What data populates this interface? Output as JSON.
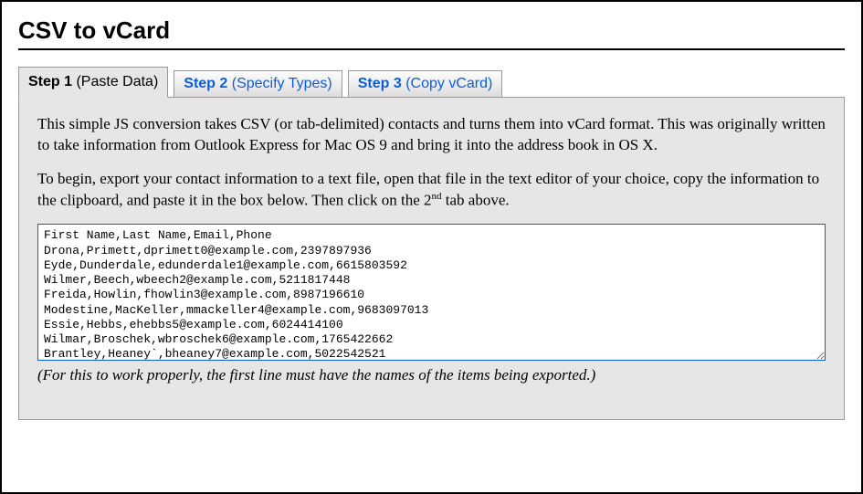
{
  "title": "CSV to vCard",
  "tabs": [
    {
      "label": "Step 1",
      "sub": "(Paste Data)",
      "active": true
    },
    {
      "label": "Step 2",
      "sub": "(Specify Types)",
      "active": false
    },
    {
      "label": "Step 3",
      "sub": "(Copy vCard)",
      "active": false
    }
  ],
  "intro_para_1": "This simple JS conversion takes CSV (or tab-delimited) contacts and turns them into vCard format. This was originally written to take information from Outlook Express for Mac OS 9 and bring it into the address book in OS X.",
  "intro_para_2_prefix": "To begin, export your contact information to a text file, open that file in the text editor of your choice, copy the information to the clipboard, and paste it in the box below. Then click on the 2",
  "intro_para_2_suffix": " tab above.",
  "textarea_value": "First Name,Last Name,Email,Phone\nDrona,Primett,dprimett0@example.com,2397897936\nEyde,Dunderdale,edunderdale1@example.com,6615803592\nWilmer,Beech,wbeech2@example.com,5211817448\nFreida,Howlin,fhowlin3@example.com,8987196610\nModestine,MacKeller,mmackeller4@example.com,9683097013\nEssie,Hebbs,ehebbs5@example.com,6024414100\nWilmar,Broschek,wbroschek6@example.com,1765422662\nBrantley,Heaney`,bheaney7@example.com,5022542521",
  "hint": "(For this to work properly, the first line must have the names of the items being exported.)"
}
